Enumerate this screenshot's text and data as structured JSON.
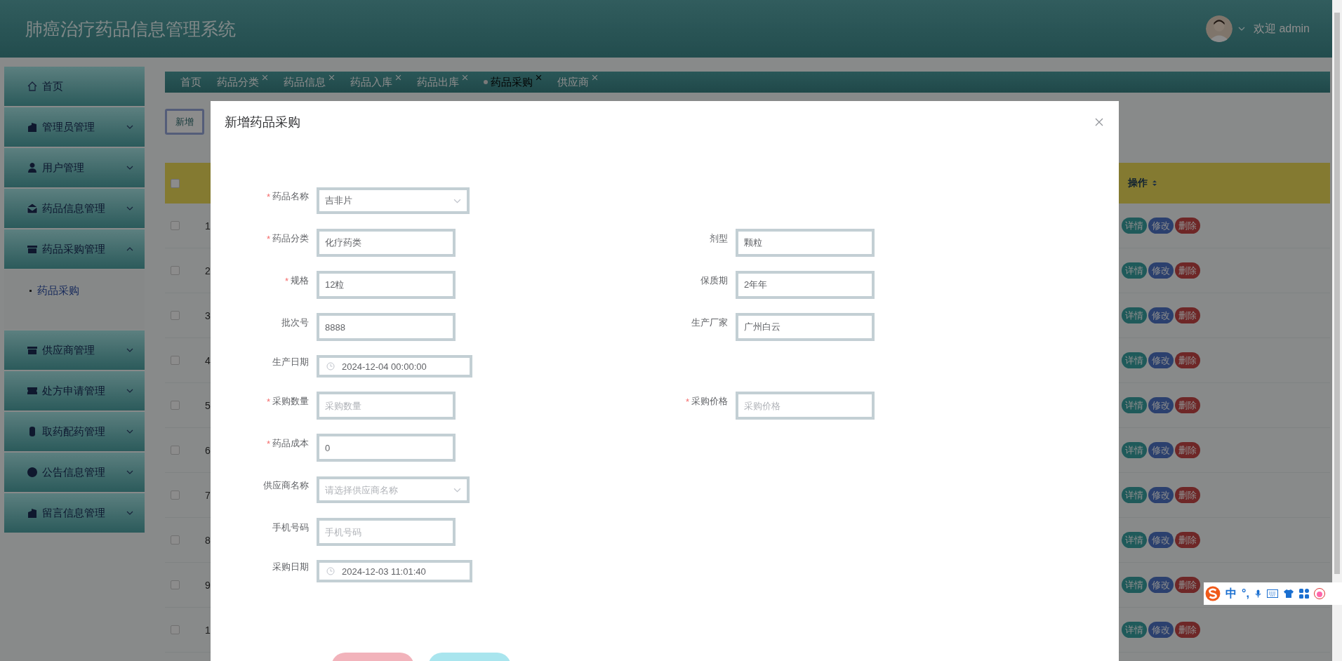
{
  "header": {
    "title": "肺癌治疗药品信息管理系统",
    "user": "欢迎 admin"
  },
  "sidebar": {
    "items": [
      {
        "label": "首页"
      },
      {
        "label": "管理员管理",
        "expanded": false
      },
      {
        "label": "用户管理",
        "expanded": false
      },
      {
        "label": "药品信息管理",
        "expanded": false
      },
      {
        "label": "药品采购管理",
        "expanded": true,
        "children": [
          {
            "label": "药品采购",
            "selected": true
          }
        ]
      },
      {
        "label": "供应商管理",
        "expanded": false
      },
      {
        "label": "处方申请管理",
        "expanded": false
      },
      {
        "label": "取药配药管理",
        "expanded": false
      },
      {
        "label": "公告信息管理",
        "expanded": false
      },
      {
        "label": "留言信息管理",
        "expanded": false
      }
    ]
  },
  "tabs": [
    {
      "label": "首页",
      "closable": false,
      "selected": false
    },
    {
      "label": "药品分类",
      "closable": true,
      "selected": false
    },
    {
      "label": "药品信息",
      "closable": true,
      "selected": false
    },
    {
      "label": "药品入库",
      "closable": true,
      "selected": false
    },
    {
      "label": "药品出库",
      "closable": true,
      "selected": false
    },
    {
      "label": "药品采购",
      "closable": true,
      "selected": true
    },
    {
      "label": "供应商",
      "closable": true,
      "selected": false
    }
  ],
  "toolbar": {
    "add_button": "新增"
  },
  "table": {
    "select_all_checked": false,
    "action_column": {
      "label": "操作",
      "sortable": true
    },
    "rows": [
      {
        "index": "1",
        "checked": false,
        "actions": [
          {
            "label": "详情",
            "kind": "detail"
          },
          {
            "label": "修改",
            "kind": "edit"
          },
          {
            "label": "删除",
            "kind": "delete"
          }
        ]
      },
      {
        "index": "2",
        "checked": false,
        "actions": [
          {
            "label": "详情",
            "kind": "detail"
          },
          {
            "label": "修改",
            "kind": "edit"
          },
          {
            "label": "删除",
            "kind": "delete"
          }
        ]
      },
      {
        "index": "3",
        "checked": false,
        "actions": [
          {
            "label": "详情",
            "kind": "detail"
          },
          {
            "label": "修改",
            "kind": "edit"
          },
          {
            "label": "删除",
            "kind": "delete"
          }
        ]
      },
      {
        "index": "4",
        "checked": false,
        "actions": [
          {
            "label": "详情",
            "kind": "detail"
          },
          {
            "label": "修改",
            "kind": "edit"
          },
          {
            "label": "删除",
            "kind": "delete"
          }
        ]
      },
      {
        "index": "5",
        "checked": false,
        "actions": [
          {
            "label": "详情",
            "kind": "detail"
          },
          {
            "label": "修改",
            "kind": "edit"
          },
          {
            "label": "删除",
            "kind": "delete"
          }
        ]
      },
      {
        "index": "6",
        "checked": false,
        "actions": [
          {
            "label": "详情",
            "kind": "detail"
          },
          {
            "label": "修改",
            "kind": "edit"
          },
          {
            "label": "删除",
            "kind": "delete"
          }
        ]
      },
      {
        "index": "7",
        "checked": false,
        "actions": [
          {
            "label": "详情",
            "kind": "detail"
          },
          {
            "label": "修改",
            "kind": "edit"
          },
          {
            "label": "删除",
            "kind": "delete"
          }
        ]
      },
      {
        "index": "8",
        "checked": false,
        "actions": [
          {
            "label": "详情",
            "kind": "detail"
          },
          {
            "label": "修改",
            "kind": "edit"
          },
          {
            "label": "删除",
            "kind": "delete"
          }
        ]
      },
      {
        "index": "9",
        "checked": false,
        "actions": [
          {
            "label": "详情",
            "kind": "detail"
          },
          {
            "label": "修改",
            "kind": "edit"
          },
          {
            "label": "删除",
            "kind": "delete"
          }
        ]
      },
      {
        "index": "1",
        "checked": false,
        "actions": [
          {
            "label": "详情",
            "kind": "detail"
          },
          {
            "label": "修改",
            "kind": "edit"
          },
          {
            "label": "删除",
            "kind": "delete"
          }
        ]
      }
    ]
  },
  "dialog": {
    "title": "新增药品采购",
    "rows": [
      {
        "kind": "field",
        "fields": [
          {
            "label": "药品名称",
            "required_mark": "*",
            "kind": "select",
            "value": "吉非片"
          }
        ]
      },
      {
        "kind": "field",
        "fields": [
          {
            "label": "药品分类",
            "required_mark": "*",
            "kind": "text",
            "value": "化疗药类"
          },
          {
            "label": "剂型",
            "kind": "text",
            "value": "颗粒"
          }
        ]
      },
      {
        "kind": "field",
        "fields": [
          {
            "label": "规格",
            "required_mark": "*",
            "kind": "text",
            "value": "12粒"
          },
          {
            "label": "保质期",
            "kind": "text",
            "value": "2年年"
          }
        ]
      },
      {
        "kind": "field",
        "fields": [
          {
            "label": "批次号",
            "kind": "text",
            "value": "8888"
          },
          {
            "label": "生产厂家",
            "kind": "text",
            "value": "广州白云"
          }
        ]
      },
      {
        "kind": "date",
        "fields": [
          {
            "label": "生产日期",
            "kind": "date",
            "value": "2024-12-04 00:00:00"
          }
        ]
      },
      {
        "kind": "field",
        "fields": [
          {
            "label": "采购数量",
            "required_mark": "*",
            "kind": "text",
            "placeholder": "采购数量"
          },
          {
            "label": "采购价格",
            "required_mark": "*",
            "kind": "text",
            "placeholder": "采购价格"
          }
        ]
      },
      {
        "kind": "field",
        "fields": [
          {
            "label": "药品成本",
            "required_mark": "*",
            "kind": "text",
            "value": "0"
          }
        ]
      },
      {
        "kind": "field",
        "fields": [
          {
            "label": "供应商名称",
            "kind": "select",
            "placeholder": "请选择供应商名称"
          }
        ]
      },
      {
        "kind": "field",
        "fields": [
          {
            "label": "手机号码",
            "kind": "text",
            "placeholder": "手机号码"
          }
        ]
      },
      {
        "kind": "date",
        "fields": [
          {
            "label": "采购日期",
            "kind": "date",
            "value": "2024-12-03 11:01:40"
          }
        ]
      }
    ],
    "buttons": [
      {
        "kind": "confirm"
      },
      {
        "kind": "cancel"
      }
    ]
  },
  "ime_bar": {
    "mode": "中",
    "punctuation": "°,"
  }
}
